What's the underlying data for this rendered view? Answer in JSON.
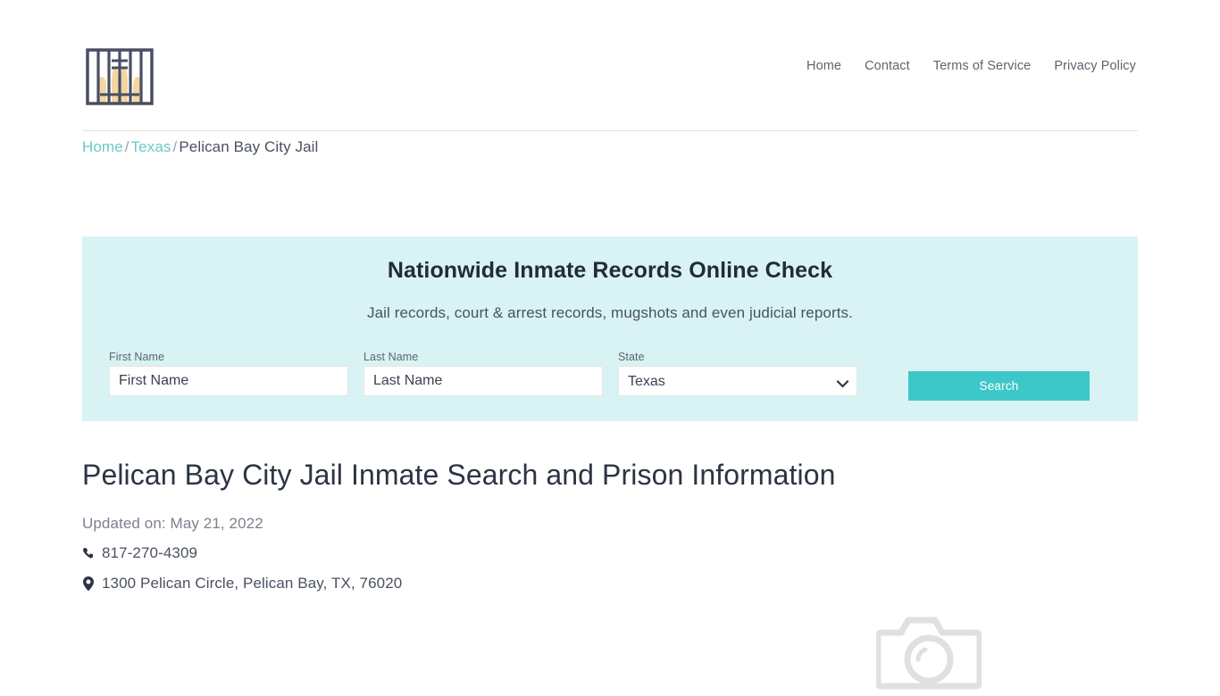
{
  "site": {
    "logo_icon": "jail-bars-hands-icon",
    "colors": {
      "accent": "#3ec7c8",
      "banner_bg": "#d9f3f4",
      "link": "#6cc8c8",
      "heading": "#222b3a",
      "body_text": "#4a5160"
    }
  },
  "nav": {
    "items": [
      {
        "label": "Home"
      },
      {
        "label": "Contact"
      },
      {
        "label": "Terms of Service"
      },
      {
        "label": "Privacy Policy"
      }
    ]
  },
  "breadcrumb": {
    "home": "Home",
    "state": "Texas",
    "current": "Pelican Bay City Jail",
    "separator": "/"
  },
  "banner": {
    "title": "Nationwide Inmate Records Online Check",
    "subtitle": "Jail records, court & arrest records, mugshots and even judicial reports.",
    "form": {
      "first_name": {
        "label": "First Name",
        "placeholder": "First Name",
        "value": ""
      },
      "last_name": {
        "label": "Last Name",
        "placeholder": "Last Name",
        "value": ""
      },
      "state": {
        "label": "State",
        "selected": "Texas",
        "options": [
          "Texas"
        ],
        "dropdown_icon": "chevron-down-icon"
      },
      "search_button": "Search"
    }
  },
  "main": {
    "page_title": "Pelican Bay City Jail Inmate Search and Prison Information",
    "updated": "Updated on: May 21, 2022",
    "phone": {
      "icon": "phone-icon",
      "value": "817-270-4309"
    },
    "address": {
      "icon": "map-pin-icon",
      "value": "1300 Pelican Circle, Pelican Bay, TX, 76020"
    },
    "photo_placeholder_icon": "camera-icon"
  }
}
